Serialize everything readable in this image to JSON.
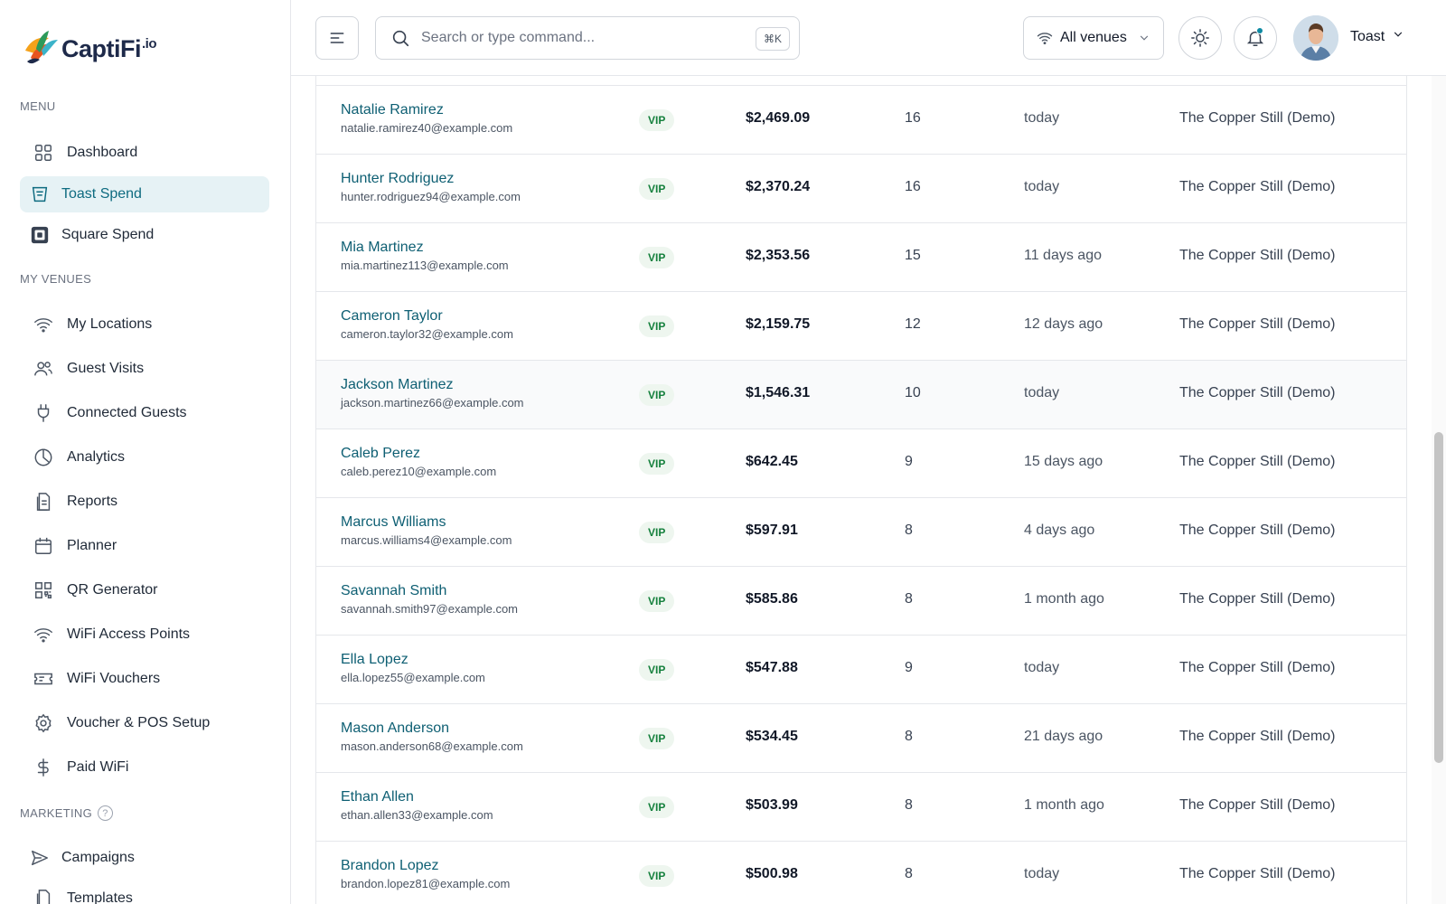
{
  "brand": {
    "name": "CaptiFi",
    "suffix": ".io"
  },
  "sidebar": {
    "menu_label": "MENU",
    "menu_items": [
      {
        "label": "Dashboard",
        "icon": "grid-icon"
      },
      {
        "label": "Toast Spend",
        "icon": "receipt-icon",
        "active": true
      },
      {
        "label": "Square Spend",
        "icon": "square-logo-icon"
      }
    ],
    "venues_label": "MY VENUES",
    "venue_items": [
      {
        "label": "My Locations",
        "icon": "wifi-icon"
      },
      {
        "label": "Guest Visits",
        "icon": "users-icon"
      },
      {
        "label": "Connected Guests",
        "icon": "plug-icon"
      },
      {
        "label": "Analytics",
        "icon": "pie-chart-icon"
      },
      {
        "label": "Reports",
        "icon": "document-icon"
      },
      {
        "label": "Planner",
        "icon": "calendar-icon"
      },
      {
        "label": "QR Generator",
        "icon": "qr-code-icon"
      },
      {
        "label": "WiFi Access Points",
        "icon": "wifi-icon"
      },
      {
        "label": "WiFi Vouchers",
        "icon": "ticket-icon"
      },
      {
        "label": "Voucher & POS Setup",
        "icon": "gear-icon"
      },
      {
        "label": "Paid WiFi",
        "icon": "dollar-icon"
      }
    ],
    "marketing_label": "MARKETING",
    "marketing_help": "?",
    "marketing_items": [
      {
        "label": "Campaigns",
        "icon": "send-icon"
      },
      {
        "label": "Templates",
        "icon": "template-icon"
      }
    ]
  },
  "header": {
    "search_placeholder": "Search or type command...",
    "search_shortcut": "⌘K",
    "venue_select": "All venues",
    "user_name": "Toast"
  },
  "table": {
    "rows": [
      {
        "name": "Natalie Ramirez",
        "email": "natalie.ramirez40@example.com",
        "tier": "VIP",
        "spend": "$2,469.09",
        "visits": "16",
        "last_visit": "today",
        "venue": "The Copper Still (Demo)"
      },
      {
        "name": "Hunter Rodriguez",
        "email": "hunter.rodriguez94@example.com",
        "tier": "VIP",
        "spend": "$2,370.24",
        "visits": "16",
        "last_visit": "today",
        "venue": "The Copper Still (Demo)"
      },
      {
        "name": "Mia Martinez",
        "email": "mia.martinez113@example.com",
        "tier": "VIP",
        "spend": "$2,353.56",
        "visits": "15",
        "last_visit": "11 days ago",
        "venue": "The Copper Still (Demo)"
      },
      {
        "name": "Cameron Taylor",
        "email": "cameron.taylor32@example.com",
        "tier": "VIP",
        "spend": "$2,159.75",
        "visits": "12",
        "last_visit": "12 days ago",
        "venue": "The Copper Still (Demo)"
      },
      {
        "name": "Jackson Martinez",
        "email": "jackson.martinez66@example.com",
        "tier": "VIP",
        "spend": "$1,546.31",
        "visits": "10",
        "last_visit": "today",
        "venue": "The Copper Still (Demo)",
        "hover": true
      },
      {
        "name": "Caleb Perez",
        "email": "caleb.perez10@example.com",
        "tier": "VIP",
        "spend": "$642.45",
        "visits": "9",
        "last_visit": "15 days ago",
        "venue": "The Copper Still (Demo)"
      },
      {
        "name": "Marcus Williams",
        "email": "marcus.williams4@example.com",
        "tier": "VIP",
        "spend": "$597.91",
        "visits": "8",
        "last_visit": "4 days ago",
        "venue": "The Copper Still (Demo)"
      },
      {
        "name": "Savannah Smith",
        "email": "savannah.smith97@example.com",
        "tier": "VIP",
        "spend": "$585.86",
        "visits": "8",
        "last_visit": "1 month ago",
        "venue": "The Copper Still (Demo)"
      },
      {
        "name": "Ella Lopez",
        "email": "ella.lopez55@example.com",
        "tier": "VIP",
        "spend": "$547.88",
        "visits": "9",
        "last_visit": "today",
        "venue": "The Copper Still (Demo)"
      },
      {
        "name": "Mason Anderson",
        "email": "mason.anderson68@example.com",
        "tier": "VIP",
        "spend": "$534.45",
        "visits": "8",
        "last_visit": "21 days ago",
        "venue": "The Copper Still (Demo)"
      },
      {
        "name": "Ethan Allen",
        "email": "ethan.allen33@example.com",
        "tier": "VIP",
        "spend": "$503.99",
        "visits": "8",
        "last_visit": "1 month ago",
        "venue": "The Copper Still (Demo)"
      },
      {
        "name": "Brandon Lopez",
        "email": "brandon.lopez81@example.com",
        "tier": "VIP",
        "spend": "$500.98",
        "visits": "8",
        "last_visit": "today",
        "venue": "The Copper Still (Demo)"
      }
    ]
  },
  "colors": {
    "accent": "#0e6b80",
    "link": "#0e5f73",
    "vip_text": "#15803d",
    "vip_bg": "#eef6ef"
  }
}
